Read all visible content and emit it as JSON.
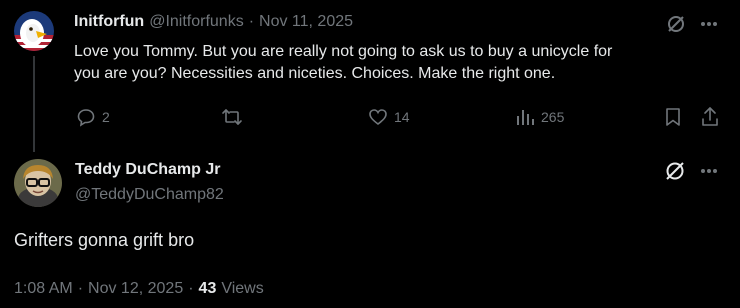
{
  "reply": {
    "display_name": "Initforfun",
    "handle": "@Initforfunks",
    "separator": "·",
    "date": "Nov 11, 2025",
    "text_line1": "Love you Tommy. But you are really not going to ask us to buy a unicycle for",
    "text_line2": "you are you?  Necessities and niceties. Choices. Make the right one.",
    "stats": {
      "replies": "2",
      "likes": "14",
      "views": "265"
    }
  },
  "main": {
    "display_name": "Teddy DuChamp Jr",
    "handle": "@TeddyDuChamp82",
    "text": "Grifters gonna grift bro",
    "time": "1:08 AM",
    "separator": "·",
    "date": "Nov 12, 2025",
    "separator2": "·",
    "views_count": "43",
    "views_label": "Views"
  },
  "icons": {
    "grok": "grok-icon",
    "more": "more-icon",
    "reply": "reply-icon",
    "repost": "repost-icon",
    "like": "like-icon",
    "views": "views-icon",
    "bookmark": "bookmark-icon",
    "share": "share-icon"
  },
  "colors": {
    "background": "#000000",
    "text": "#e7e9ea",
    "muted": "#71767b"
  }
}
